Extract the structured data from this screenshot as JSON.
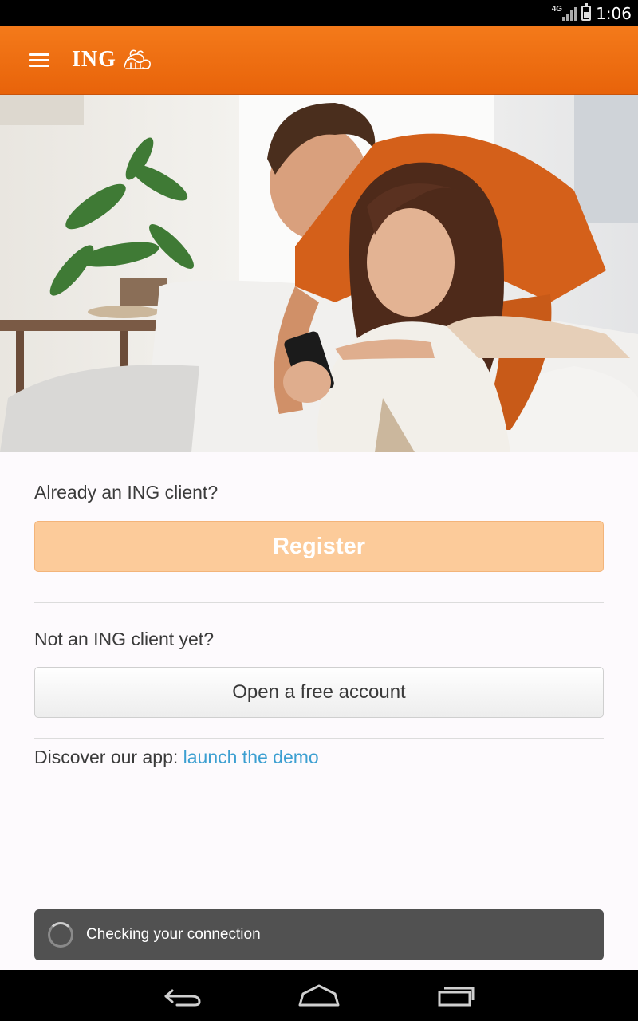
{
  "status_bar": {
    "network": "4G",
    "time": "1:06"
  },
  "app_bar": {
    "logo_text": "ING",
    "menu_icon": "hamburger-menu-icon",
    "logo_icon": "lion-logo-icon"
  },
  "hero": {
    "description_icon": "hero-photo-couple-with-phone"
  },
  "existing_client": {
    "question": "Already an ING client?",
    "register_label": "Register"
  },
  "new_client": {
    "question": "Not an ING client yet?",
    "open_account_label": "Open a free account"
  },
  "demo": {
    "prefix": "Discover our app: ",
    "link_text": "launch the demo"
  },
  "toast": {
    "message": "Checking your connection"
  },
  "colors": {
    "brand_orange": "#f47a1a",
    "register_bg": "#fccb9a",
    "link_blue": "#3c9fd1",
    "toast_bg": "#515151"
  },
  "nav_bar": {
    "back_icon": "back-icon",
    "home_icon": "home-icon",
    "recents_icon": "recent-apps-icon"
  }
}
